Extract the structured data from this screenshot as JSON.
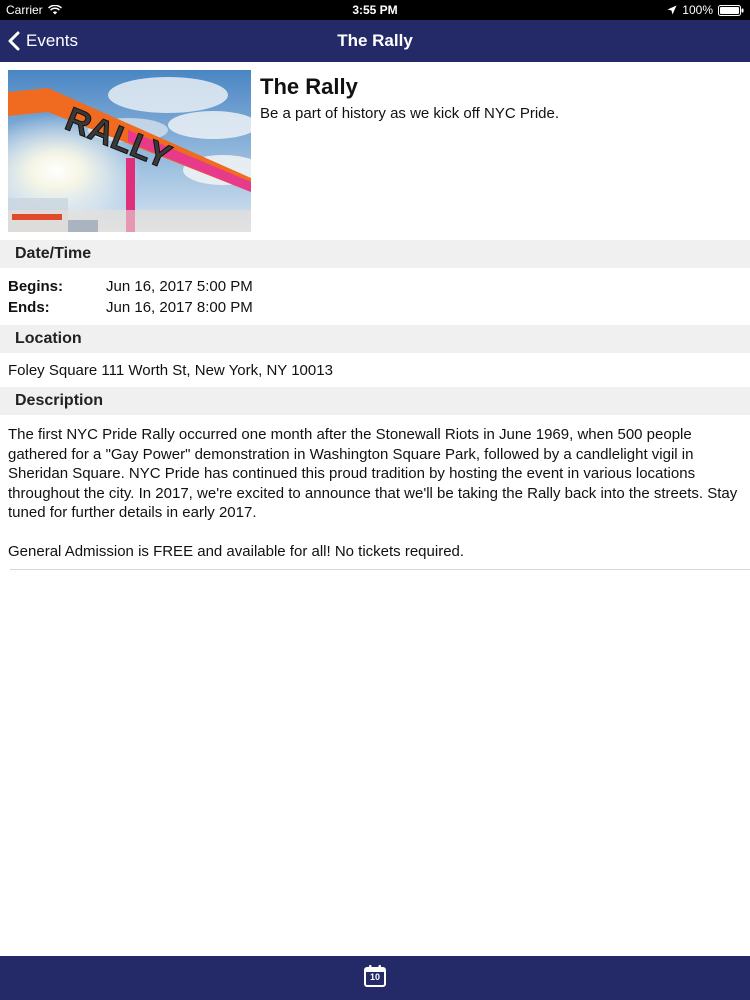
{
  "status_bar": {
    "carrier": "Carrier",
    "time": "3:55 PM",
    "battery": "100%"
  },
  "nav": {
    "back_label": "Events",
    "title": "The Rally"
  },
  "event": {
    "title": "The Rally",
    "subtitle": "Be a part of history as we kick off NYC Pride.",
    "image_sign_text": "RALLY"
  },
  "datetime": {
    "header": "Date/Time",
    "begins_label": "Begins:",
    "begins_value": "Jun 16, 2017 5:00 PM",
    "ends_label": "Ends:",
    "ends_value": "Jun 16, 2017 8:00 PM"
  },
  "location": {
    "header": "Location",
    "value": "Foley Square 111 Worth St, New York, NY 10013"
  },
  "description": {
    "header": "Description",
    "text": "The first NYC Pride Rally occurred one month after the Stonewall Riots in June 1969, when 500 people gathered for a \"Gay Power\" demonstration in Washington Square Park, followed by a candlelight vigil in Sheridan Square. NYC Pride has continued this proud tradition by hosting the event in various locations throughout the city. In 2017, we're excited to announce that we'll be taking the Rally back into the streets. Stay tuned for further details in early 2017.\n\nGeneral Admission is FREE and available for all! No tickets required."
  },
  "tab_bar": {
    "calendar_day": "10"
  },
  "colors": {
    "nav_background": "#232a67",
    "section_background": "#f0f0f0"
  }
}
